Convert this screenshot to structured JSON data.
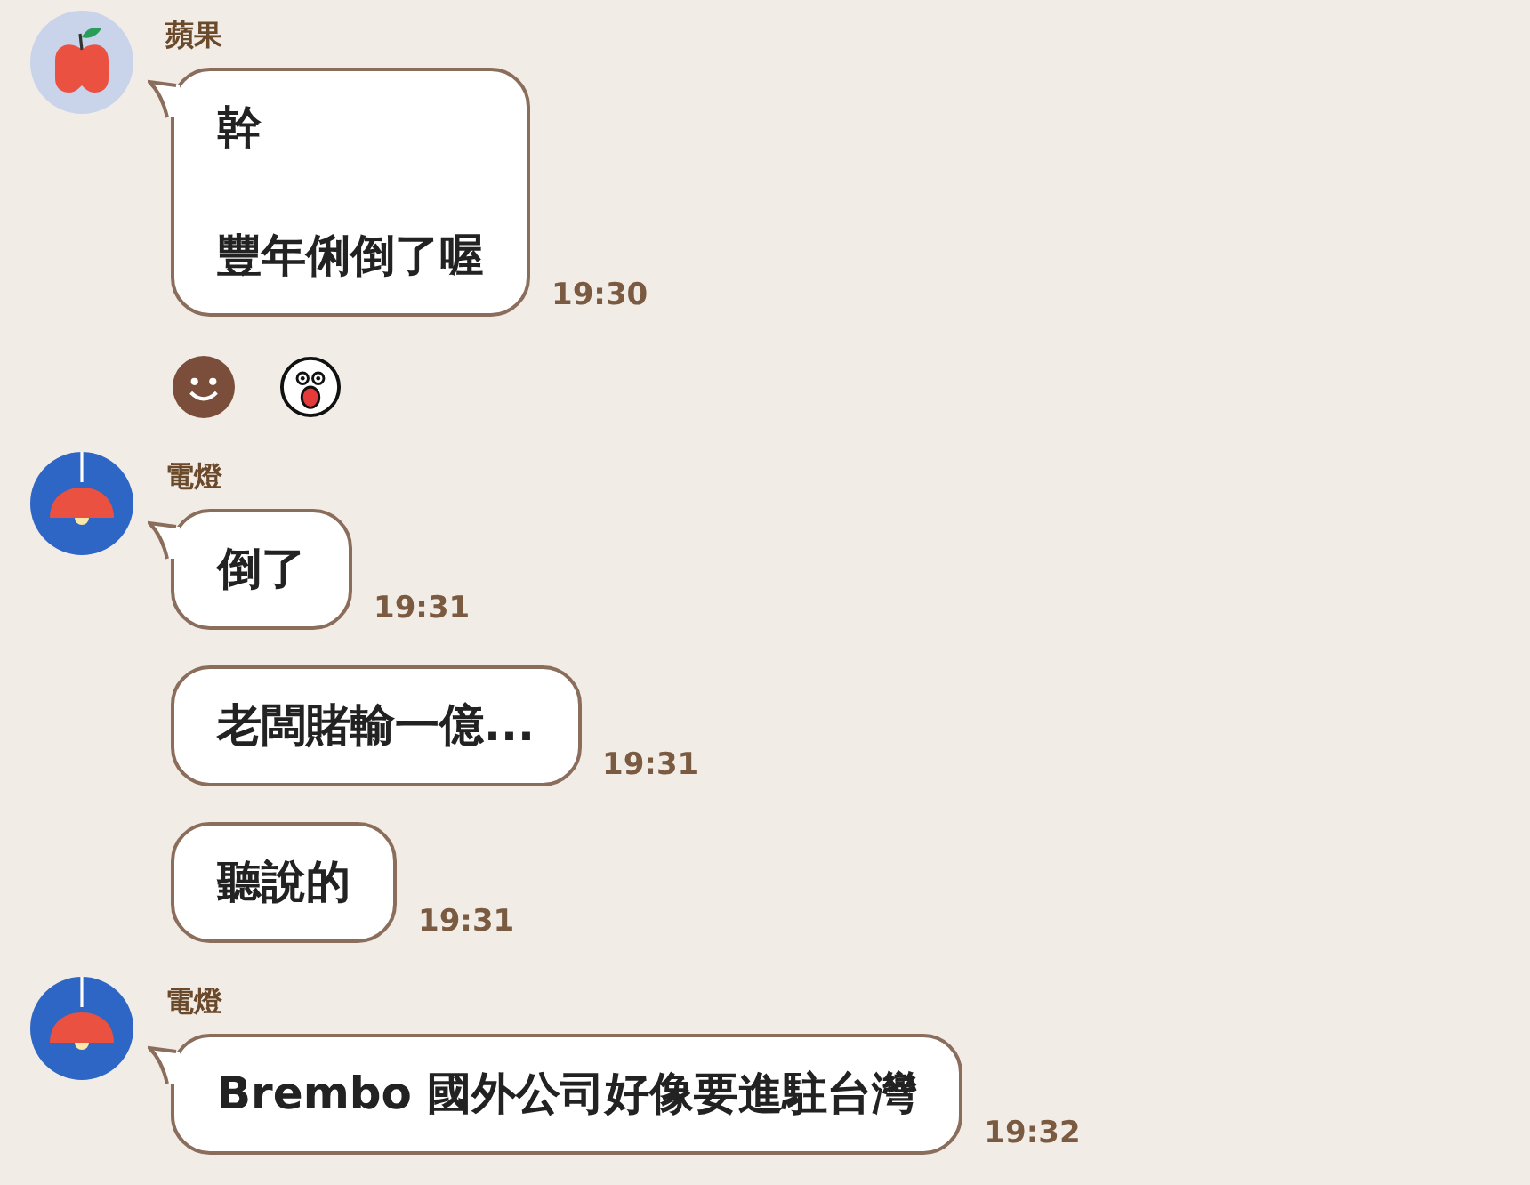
{
  "groups": [
    {
      "sender": "蘋果",
      "avatar": {
        "kind": "apple"
      },
      "messages": [
        {
          "paragraphs": [
            "幹",
            "豐年俐倒了喔"
          ],
          "time": "19:30"
        }
      ],
      "reactions": [
        {
          "kind": "smile"
        },
        {
          "kind": "shocked"
        }
      ]
    },
    {
      "sender": "電燈",
      "avatar": {
        "kind": "lamp"
      },
      "messages": [
        {
          "paragraphs": [
            "倒了"
          ],
          "time": "19:31"
        },
        {
          "paragraphs": [
            "老闆賭輸一億..."
          ],
          "time": "19:31"
        },
        {
          "paragraphs": [
            "聽說的"
          ],
          "time": "19:31"
        }
      ]
    },
    {
      "sender": "電燈",
      "avatar": {
        "kind": "lamp"
      },
      "messages": [
        {
          "paragraphs": [
            "Brembo 國外公司好像要進駐台灣"
          ],
          "time": "19:32"
        }
      ]
    }
  ]
}
